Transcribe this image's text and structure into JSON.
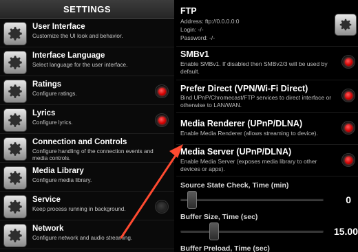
{
  "settings": {
    "header": "SETTINGS",
    "items": [
      {
        "title": "User Interface",
        "desc": "Customize the UI look and behavior.",
        "toggle": null
      },
      {
        "title": "Interface Language",
        "desc": "Select language for the user interface.",
        "toggle": null
      },
      {
        "title": "Ratings",
        "desc": "Configure ratings.",
        "toggle": "on"
      },
      {
        "title": "Lyrics",
        "desc": "Configure lyrics.",
        "toggle": "on"
      },
      {
        "title": "Connection and Controls",
        "desc": "Configure handling of the connection events and media controls.",
        "toggle": null
      },
      {
        "title": "Media Library",
        "desc": "Configure media library.",
        "toggle": null
      },
      {
        "title": "Service",
        "desc": "Keep process running in background.",
        "toggle": "off"
      },
      {
        "title": "Network",
        "desc": "Configure network and audio streaming.",
        "toggle": null
      }
    ]
  },
  "network": {
    "ftp": {
      "title": "FTP",
      "address": "Address: ftp://0.0.0.0:0",
      "login": "Login: -/-",
      "password": "Password: -/-"
    },
    "options": [
      {
        "title": "SMBv1",
        "desc": "Enable SMBv1. If disabled then SMBv2/3 will be used by default.",
        "toggle": "on"
      },
      {
        "title": "Prefer Direct (VPN/Wi-Fi Direct)",
        "desc": "Bind UPnP/Chromecast/FTP services to direct interface or otherwise to LAN/WAN.",
        "toggle": "on"
      },
      {
        "title": "Media Renderer (UPnP/DLNA)",
        "desc": "Enable Media Renderer (allows streaming to device).",
        "toggle": "on"
      },
      {
        "title": "Media Server (UPnP/DLNA)",
        "desc": "Enable Media Server (exposes media library to other devices or apps).",
        "toggle": "on"
      }
    ],
    "sliders": [
      {
        "label": "Source State Check, Time (min)",
        "value": "0",
        "level": 0.05
      },
      {
        "label": "Buffer Size, Time (sec)",
        "value": "15.00",
        "level": 0.2
      },
      {
        "label": "Buffer Preload, Time (sec)",
        "value": "",
        "level": 0
      }
    ]
  },
  "colors": {
    "toggle_on": "#e00000",
    "arrow": "#ff4a30"
  },
  "icons": {
    "settings_icon": "gear-icon",
    "annotation": "arrow-annotation"
  }
}
